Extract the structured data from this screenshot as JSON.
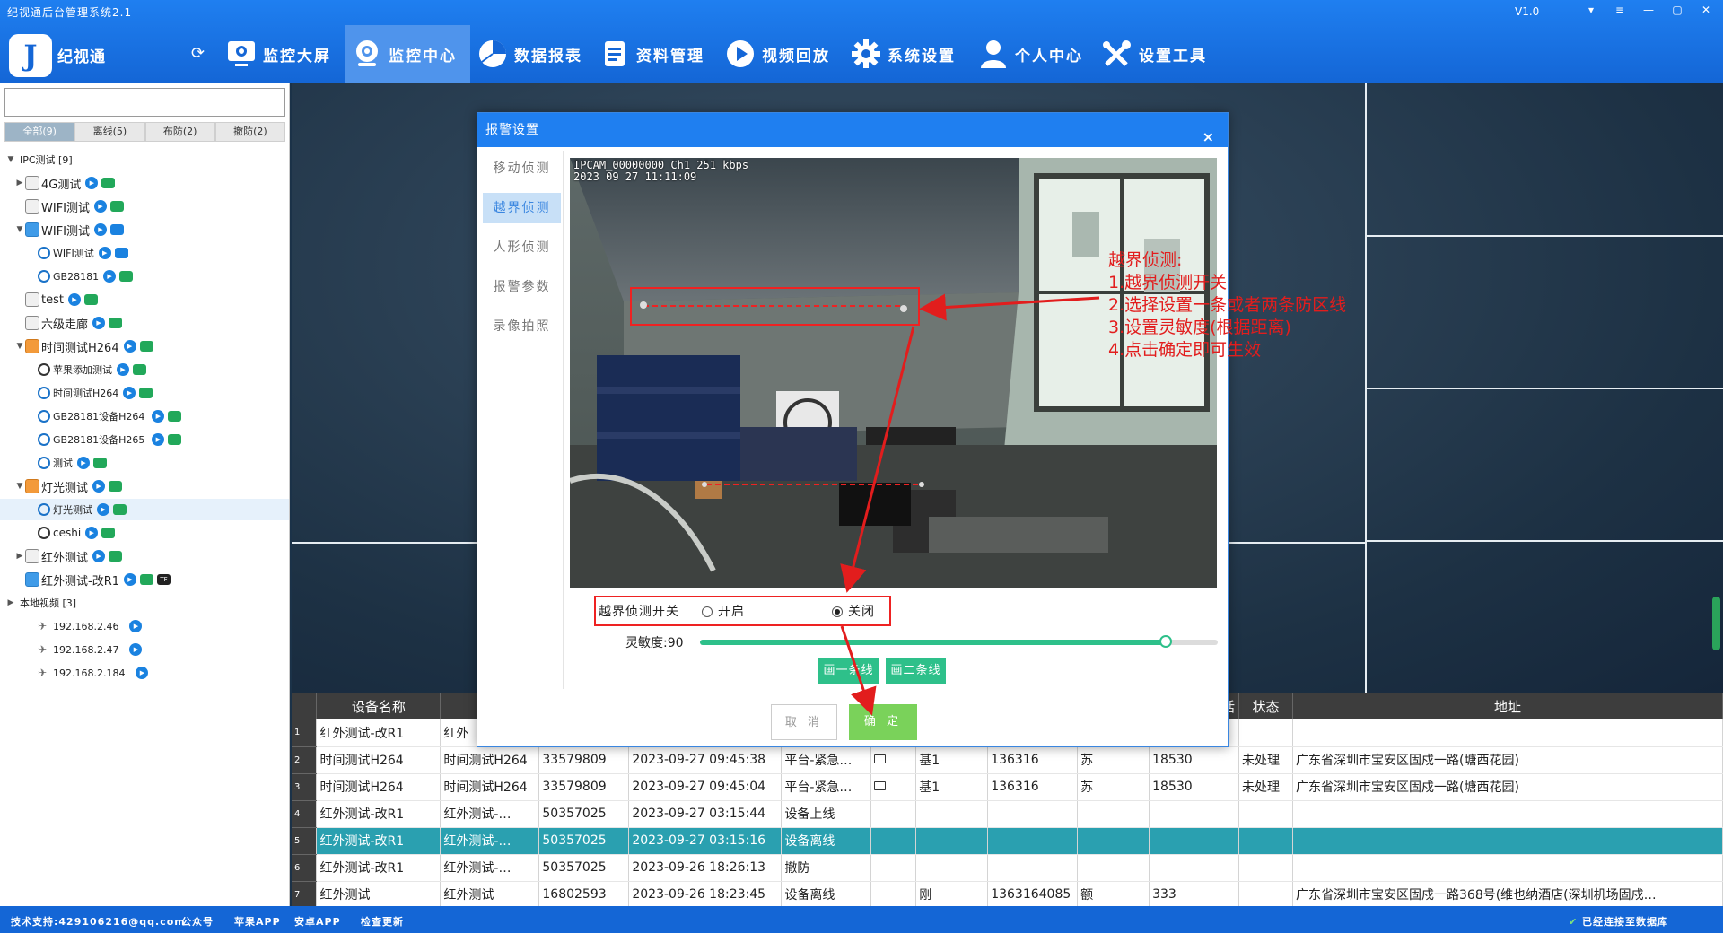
{
  "titlebar": {
    "title": "纪视通后台管理系统2.1",
    "version": "V1.0"
  },
  "brand": {
    "name": "纪视通",
    "logo_glyph": "J"
  },
  "nav": [
    {
      "label": "监控大屏",
      "icon": "monitor-icon"
    },
    {
      "label": "监控中心",
      "icon": "camera-icon",
      "active": true
    },
    {
      "label": "数据报表",
      "icon": "pie-chart-icon"
    },
    {
      "label": "资料管理",
      "icon": "document-icon"
    },
    {
      "label": "视频回放",
      "icon": "play-icon"
    },
    {
      "label": "系统设置",
      "icon": "gear-icon"
    },
    {
      "label": "个人中心",
      "icon": "user-icon"
    },
    {
      "label": "设置工具",
      "icon": "tools-icon"
    }
  ],
  "left": {
    "search_placeholder": "",
    "tabs": [
      "全部(9)",
      "离线(5)",
      "布防(2)",
      "撤防(2)"
    ],
    "tree": {
      "group_ipc": "IPC测试 [9]",
      "n_4g": "4G测试",
      "n_wifi1": "WIFI测试",
      "n_wifi2": "WIFI测试",
      "n_wifi2_cam": "WIFI测试",
      "n_gb1": "GB28181",
      "n_test": "test",
      "n_lj": "六级走廊",
      "n_time": "时间测试H264",
      "n_time_c1": "苹果添加测试",
      "n_time_c2": "时间测试H264",
      "n_time_c3": "GB28181设备H264",
      "n_time_c4": "GB28181设备H265",
      "n_time_c5": "测试",
      "n_light": "灯光测试",
      "n_light_c1": "灯光测试",
      "n_ceshi": "ceshi",
      "n_ir": "红外测试",
      "n_ir2": "红外测试-改R1",
      "group_local": "本地视频 [3]",
      "ip1": "192.168.2.46",
      "ip2": "192.168.2.47",
      "ip3": "192.168.2.184"
    }
  },
  "table": {
    "headers": [
      "设备名称",
      "",
      "",
      "",
      "",
      "",
      "",
      "",
      "",
      "话",
      "状态",
      "地址"
    ],
    "rows": [
      {
        "n": "1",
        "c": [
          "红外测试-改R1",
          "红外",
          "",
          "",
          "",
          "",
          "",
          "",
          "",
          "",
          "",
          ""
        ]
      },
      {
        "n": "2",
        "c": [
          "时间测试H264",
          "时间测试H264",
          "33579809",
          "2023-09-27  09:45:38",
          "平台-紧急…",
          "pic",
          "基1",
          "136316",
          "苏",
          "18530",
          "未处理",
          "广东省深圳市宝安区固戍一路(塘西花园)"
        ]
      },
      {
        "n": "3",
        "c": [
          "时间测试H264",
          "时间测试H264",
          "33579809",
          "2023-09-27  09:45:04",
          "平台-紧急…",
          "pic",
          "基1",
          "136316",
          "苏",
          "18530",
          "未处理",
          "广东省深圳市宝安区固戍一路(塘西花园)"
        ]
      },
      {
        "n": "4",
        "c": [
          "红外测试-改R1",
          "红外测试-…",
          "50357025",
          "2023-09-27  03:15:44",
          "设备上线",
          "",
          "",
          "",
          "",
          "",
          "",
          ""
        ]
      },
      {
        "n": "5",
        "c": [
          "红外测试-改R1",
          "红外测试-…",
          "50357025",
          "2023-09-27  03:15:16",
          "设备离线",
          "",
          "",
          "",
          "",
          "",
          "",
          ""
        ],
        "hl": true
      },
      {
        "n": "6",
        "c": [
          "红外测试-改R1",
          "红外测试-…",
          "50357025",
          "2023-09-26  18:26:13",
          "撤防",
          "",
          "",
          "",
          "",
          "",
          "",
          ""
        ]
      },
      {
        "n": "7",
        "c": [
          "红外测试",
          "红外测试",
          "16802593",
          "2023-09-26  18:23:45",
          "设备离线",
          "",
          "刚",
          "1363164085",
          "额",
          "333",
          "",
          "广东省深圳市宝安区固戍一路368号(维也纳酒店(深圳机场固戍…"
        ]
      }
    ]
  },
  "statusbar": {
    "support": "技术支持:429106216@qq.com",
    "wechat": "公众号",
    "apple": "苹果APP",
    "android": "安卓APP",
    "update": "检查更新",
    "connected": "已经连接至数据库"
  },
  "dialog": {
    "title": "报警设置",
    "side": [
      "移动侦测",
      "越界侦测",
      "人形侦测",
      "报警参数",
      "录像拍照"
    ],
    "active_side": 1,
    "osd_line1": "IPCAM_00000000 Ch1    251 kbps",
    "osd_line2": "2023 09 27 11:11:09",
    "switch_label": "越界侦测开关",
    "opt_on": "开启",
    "opt_off": "关闭",
    "selected_option": "关闭",
    "sensitivity_label": "灵敏度:90",
    "sensitivity_value": 90,
    "btn_line1": "画一条线",
    "btn_line2": "画二条线",
    "cancel": "取 消",
    "ok": "确 定",
    "close": "×"
  },
  "annotation": {
    "lines": [
      "越界侦测:",
      "1.越界侦测开关",
      "2.选择设置一条或者两条防区线",
      "3.设置灵敏度(根据距离)",
      "4.点击确定即可生效"
    ],
    "color": "#e21d1d"
  },
  "colors": {
    "primary": "#1466d6",
    "accent": "#2ec08a",
    "highlight_row": "#2aa0b0"
  }
}
